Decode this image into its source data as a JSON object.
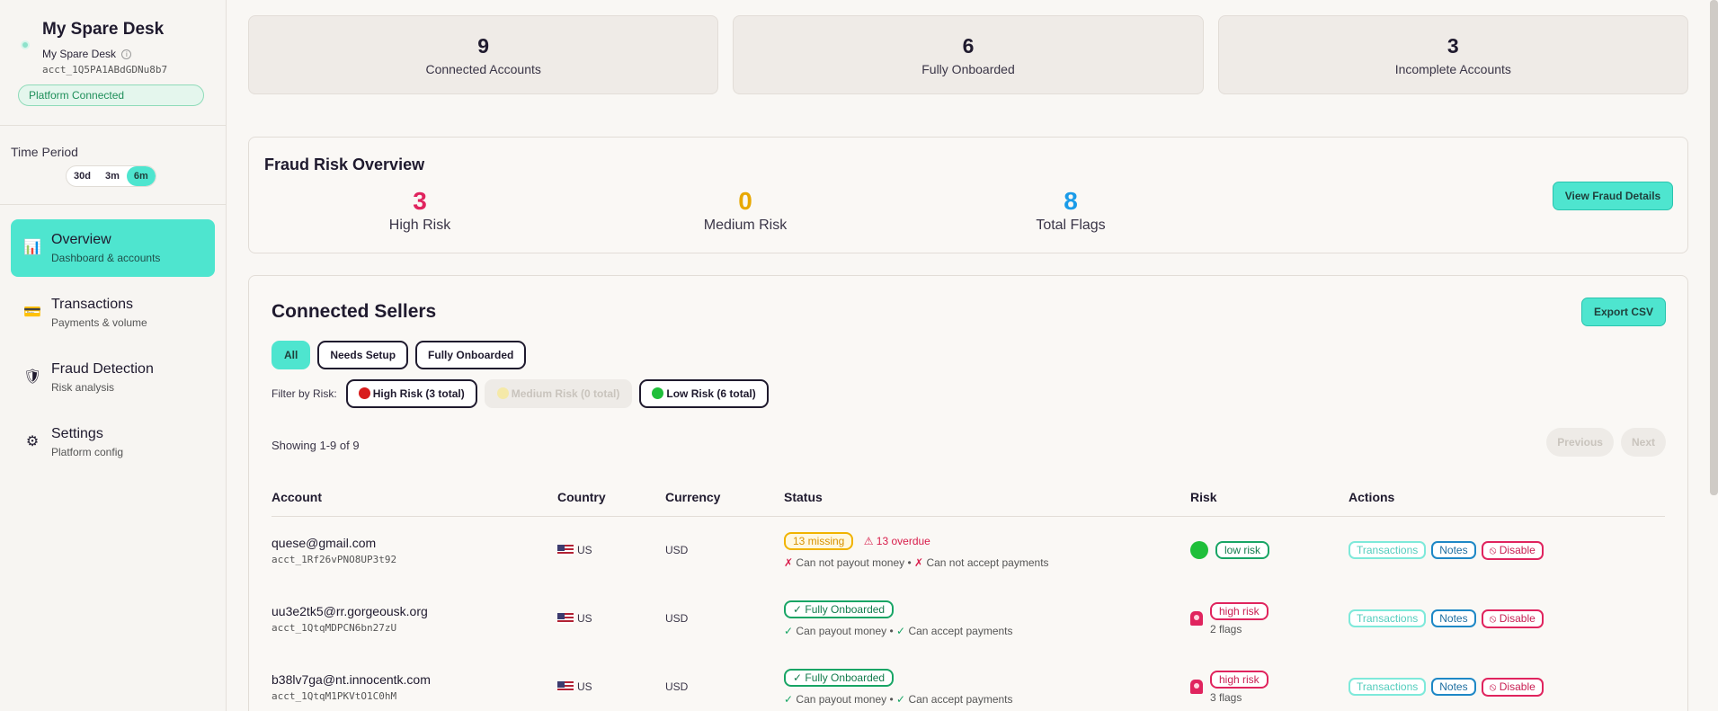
{
  "sidebar": {
    "brand_name": "My Spare Desk",
    "brand_sub": "My Spare Desk",
    "info_glyph": "i",
    "account_id": "acct_1Q5PA1ABdGDNu8b7",
    "platform_badge": "Platform Connected",
    "time_period_label": "Time Period",
    "periods": [
      "30d",
      "3m",
      "6m"
    ],
    "active_period": "6m",
    "nav": [
      {
        "title": "Overview",
        "sub": "Dashboard & accounts",
        "icon": "bar-chart-icon",
        "glyph": "📊",
        "active": true
      },
      {
        "title": "Transactions",
        "sub": "Payments & volume",
        "icon": "credit-card-icon",
        "glyph": "💳",
        "active": false
      },
      {
        "title": "Fraud Detection",
        "sub": "Risk analysis",
        "icon": "shield-icon",
        "glyph": "🛡",
        "active": false
      },
      {
        "title": "Settings",
        "sub": "Platform config",
        "icon": "gear-icon",
        "glyph": "⚙",
        "active": false
      }
    ]
  },
  "stats": [
    {
      "value": "9",
      "label": "Connected Accounts"
    },
    {
      "value": "6",
      "label": "Fully Onboarded"
    },
    {
      "value": "3",
      "label": "Incomplete Accounts"
    }
  ],
  "fraud": {
    "title": "Fraud Risk Overview",
    "metrics": [
      {
        "value": "3",
        "label": "High Risk",
        "color": "#e0245e"
      },
      {
        "value": "0",
        "label": "Medium Risk",
        "color": "#e8a800"
      },
      {
        "value": "8",
        "label": "Total Flags",
        "color": "#1a9be8"
      }
    ],
    "button": "View Fraud Details"
  },
  "sellers": {
    "title": "Connected Sellers",
    "export_label": "Export CSV",
    "filters": [
      "All",
      "Needs Setup",
      "Fully Onboarded"
    ],
    "active_filter": "All",
    "risk_filter_label": "Filter by Risk:",
    "risk_filters": [
      {
        "label": "High Risk (3 total)",
        "color": "#d81c1c",
        "disabled": false
      },
      {
        "label": "Medium Risk (0 total)",
        "color": "#f1c40f",
        "disabled": true
      },
      {
        "label": "Low Risk (6 total)",
        "color": "#1fbf3a",
        "disabled": false
      }
    ],
    "showing": "Showing 1-9 of 9",
    "prev_label": "Previous",
    "next_label": "Next",
    "columns": [
      "Account",
      "Country",
      "Currency",
      "Status",
      "Risk",
      "Actions"
    ],
    "rows": [
      {
        "email": "quese@gmail.com",
        "account_id": "acct_1Rf26vPNO8UP3t92",
        "country": "US",
        "currency": "USD",
        "status_tag": "13 missing",
        "status_type": "missing",
        "overdue": "⚠ 13 overdue",
        "payout_mark": "✗",
        "payout": "Can not payout money",
        "separator": "•",
        "accept_mark": "✗",
        "accept": "Can not accept payments",
        "risk_tag": "low risk",
        "risk_type": "low",
        "flags": ""
      },
      {
        "email": "uu3e2tk5@rr.gorgeousk.org",
        "account_id": "acct_1QtqMDPCN6bn27zU",
        "country": "US",
        "currency": "USD",
        "status_tag": "✓ Fully Onboarded",
        "status_type": "onboarded",
        "overdue": "",
        "payout_mark": "✓",
        "payout": "Can payout money",
        "separator": "•",
        "accept_mark": "✓",
        "accept": "Can accept payments",
        "risk_tag": "high risk",
        "risk_type": "high",
        "flags": "2 flags"
      },
      {
        "email": "b38lv7ga@nt.innocentk.com",
        "account_id": "acct_1QtqM1PKVtO1C0hM",
        "country": "US",
        "currency": "USD",
        "status_tag": "✓ Fully Onboarded",
        "status_type": "onboarded",
        "overdue": "",
        "payout_mark": "✓",
        "payout": "Can payout money",
        "separator": "•",
        "accept_mark": "✓",
        "accept": "Can accept payments",
        "risk_tag": "high risk",
        "risk_type": "high",
        "flags": "3 flags"
      }
    ],
    "actions": {
      "transactions": "Transactions",
      "notes": "Notes",
      "disable": "⦸ Disable"
    }
  }
}
